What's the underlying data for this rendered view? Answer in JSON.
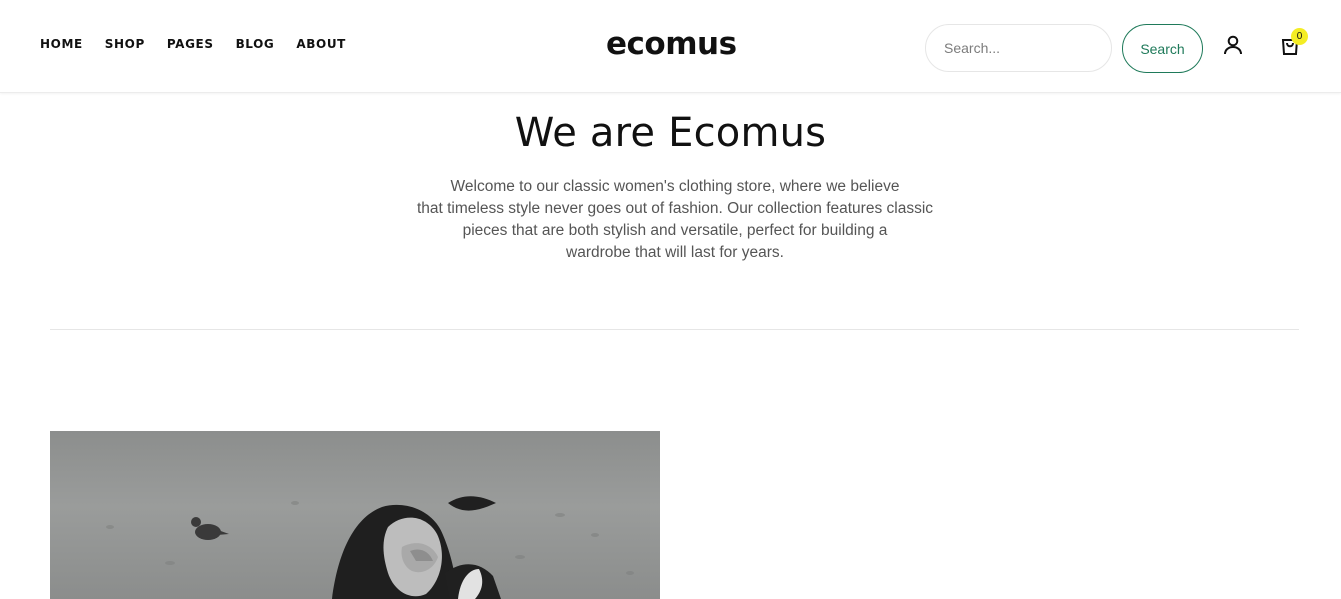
{
  "nav": {
    "items": [
      "HOME",
      "SHOP",
      "PAGES",
      "BLOG",
      "ABOUT"
    ]
  },
  "brand": {
    "logo_text": "ecomus"
  },
  "search": {
    "placeholder": "Search...",
    "button_label": "Search"
  },
  "cart": {
    "count": "0"
  },
  "hero": {
    "title": "We are Ecomus",
    "text_lines": [
      "Welcome to our classic women's clothing store, where we believe",
      "that timeless style never goes out of fashion. Our collection features classic",
      "pieces that are both stylish and versatile, perfect for building a",
      "wardrobe that will last for years."
    ]
  },
  "colors": {
    "accent": "#1f7a5a",
    "badge": "#f4ed24"
  },
  "icons": {
    "user": "user-icon",
    "cart": "shopping-bag-icon"
  }
}
